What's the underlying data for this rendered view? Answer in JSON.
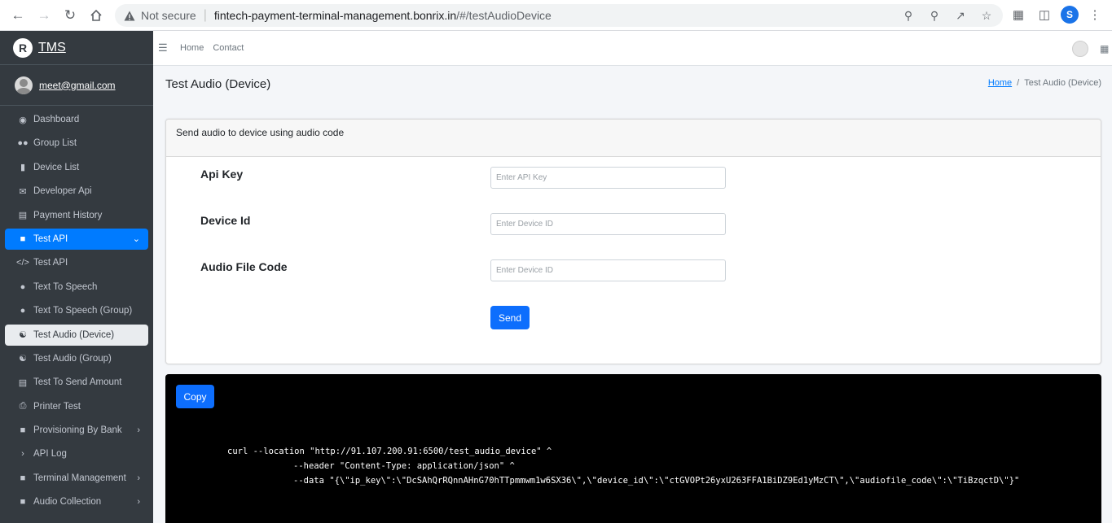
{
  "browser": {
    "security_label": "Not secure",
    "url_host": "fintech-payment-terminal-management.bonrix.in",
    "url_path": "/#/testAudioDevice",
    "profile_initial": "S"
  },
  "sidebar": {
    "brand_logo": "R",
    "brand": "TMS",
    "user_email": "meet@gmail.com",
    "items": [
      {
        "label": "Dashboard",
        "icon": "dashboard-icon"
      },
      {
        "label": "Group List",
        "icon": "users-icon"
      },
      {
        "label": "Device List",
        "icon": "mobile-icon"
      },
      {
        "label": "Developer Api",
        "icon": "envelope-open-icon"
      },
      {
        "label": "Payment History",
        "icon": "credit-card-icon"
      },
      {
        "label": "Test API",
        "icon": "folder-icon"
      },
      {
        "label": "Test API",
        "icon": "code-icon"
      },
      {
        "label": "Text To Speech",
        "icon": "comment-icon"
      },
      {
        "label": "Text To Speech (Group)",
        "icon": "comment-icon"
      },
      {
        "label": "Test Audio (Device)",
        "icon": "headphones-icon"
      },
      {
        "label": "Test Audio (Group)",
        "icon": "headphones-icon"
      },
      {
        "label": "Test To Send Amount",
        "icon": "credit-card-icon"
      },
      {
        "label": "Printer Test",
        "icon": "printer-icon"
      },
      {
        "label": "Provisioning By Bank",
        "icon": "folder-icon"
      },
      {
        "label": "API Log",
        "icon": "chevron-right-icon"
      },
      {
        "label": "Terminal Management",
        "icon": "folder-icon"
      },
      {
        "label": "Audio Collection",
        "icon": "folder-icon"
      }
    ]
  },
  "topnav": {
    "home": "Home",
    "contact": "Contact"
  },
  "page": {
    "title": "Test Audio (Device)",
    "breadcrumb_home": "Home",
    "breadcrumb_sep": "/",
    "breadcrumb_current": "Test Audio (Device)"
  },
  "form": {
    "header": "Send audio to device using audio code",
    "api_key_label": "Api Key",
    "api_key_placeholder": "Enter API Key",
    "device_id_label": "Device Id",
    "device_id_placeholder": "Enter Device ID",
    "audio_code_label": "Audio File Code",
    "audio_code_placeholder": "Enter Device ID",
    "send_label": "Send"
  },
  "code": {
    "copy_label": "Copy",
    "line1": "curl --location \"http://91.107.200.91:6500/test_audio_device\" ^",
    "line2": "--header \"Content-Type: application/json\" ^",
    "line3": "--data \"{\\\"ip_key\\\":\\\"DcSAhQrRQnnAHnG70hTTpmmwm1w6SX36\\\",\\\"device_id\\\":\\\"ctGVOPt26yxU263FFA1BiDZ9Ed1yMzCT\\\",\\\"audiofile_code\\\":\\\"TiBzqctD\\\"}\""
  },
  "colors": {
    "sidebar_bg": "#343a40",
    "primary": "#007bff",
    "button": "#0d6efd",
    "code_bg": "#000000"
  }
}
